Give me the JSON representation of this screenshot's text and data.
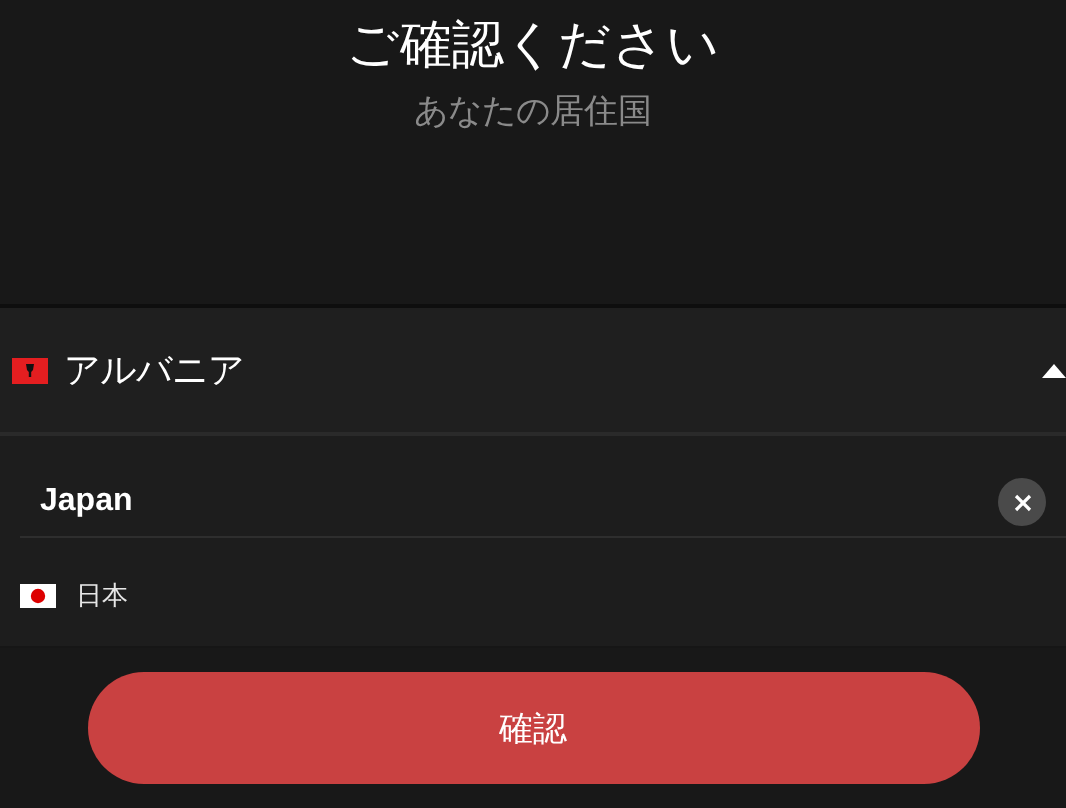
{
  "heading": {
    "title": "ご確認ください",
    "subtitle": "あなたの居住国"
  },
  "country_select": {
    "value": "アルバニア",
    "expanded": true
  },
  "search": {
    "value": "Japan"
  },
  "options": [
    {
      "label": "日本",
      "selected": false
    }
  ],
  "confirm_button": "確認"
}
